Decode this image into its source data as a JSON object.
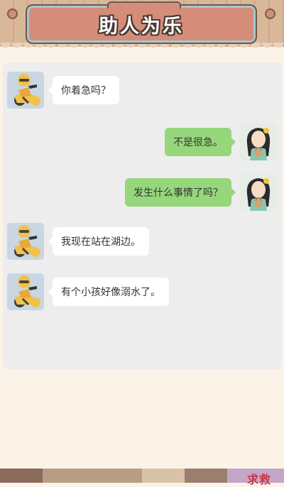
{
  "header": {
    "title": "助人为乐"
  },
  "messages": [
    {
      "side": "left",
      "speaker": "rider",
      "text": "你着急吗？"
    },
    {
      "side": "right",
      "speaker": "girl",
      "text": "不是很急。"
    },
    {
      "side": "right",
      "speaker": "girl",
      "text": "发生什么事情了吗？"
    },
    {
      "side": "left",
      "speaker": "rider",
      "text": "我现在站在湖边。"
    },
    {
      "side": "left",
      "speaker": "rider",
      "text": "有个小孩好像溺水了。"
    }
  ],
  "bottom": {
    "partial_text": "求救"
  },
  "colors": {
    "left_bubble": "#ffffff",
    "right_bubble": "#95d77a",
    "chat_bg": "#ededed",
    "page_bg": "#fcf3e8",
    "title_plate": "#d58d79"
  }
}
